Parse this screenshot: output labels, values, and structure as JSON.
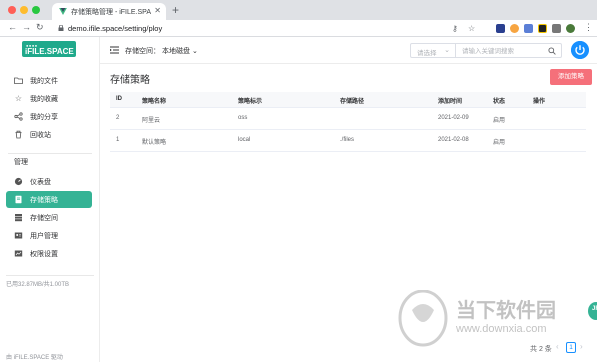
{
  "browser": {
    "tab_title": "存储策略管理 - iFILE.SPACE 个人",
    "url": "demo.ifile.space/setting/ploy"
  },
  "sidebar": {
    "logo_text": "iFILE.SPACE",
    "items": [
      {
        "label": "我的文件",
        "icon": "folder-icon"
      },
      {
        "label": "我的收藏",
        "icon": "star-icon"
      },
      {
        "label": "我的分享",
        "icon": "share-icon"
      },
      {
        "label": "回收站",
        "icon": "trash-icon"
      }
    ],
    "section_label": "管理",
    "admin_items": [
      {
        "label": "仪表盘",
        "icon": "dashboard-icon"
      },
      {
        "label": "存储策略",
        "icon": "storage-policy-icon",
        "active": true
      },
      {
        "label": "存储空间",
        "icon": "storage-space-icon"
      },
      {
        "label": "用户管理",
        "icon": "user-icon"
      },
      {
        "label": "权限设置",
        "icon": "permission-icon"
      }
    ],
    "storage_usage": "已用32.87MB/共1.00TB",
    "footer": "由 iFILE.SPACE 驱动"
  },
  "header": {
    "space_label": "存储空间：",
    "space_value": "本地磁盘",
    "filter_placeholder": "请选择",
    "search_placeholder": "请输入关键词搜索"
  },
  "main": {
    "title": "存储策略",
    "add_button": "添加策略",
    "columns": [
      "ID",
      "策略名称",
      "策略标示",
      "存储路径",
      "添加时间",
      "状态",
      "操作"
    ],
    "rows": [
      {
        "id": "2",
        "name": "阿里云",
        "tag": "oss",
        "path": "",
        "time": "2021-02-09",
        "status": "启用",
        "action": ""
      },
      {
        "id": "1",
        "name": "默认策略",
        "tag": "local",
        "path": "./files",
        "time": "2021-02-08",
        "status": "启用",
        "action": ""
      }
    ],
    "pager_total": "共 2 条",
    "pager_page": "1"
  },
  "watermark": {
    "brand": "当下软件园",
    "url": "www.downxia.com"
  },
  "colors": {
    "accent": "#35b395",
    "logo": "#20a98b",
    "danger": "#f5707a",
    "primary": "#1890ff"
  }
}
